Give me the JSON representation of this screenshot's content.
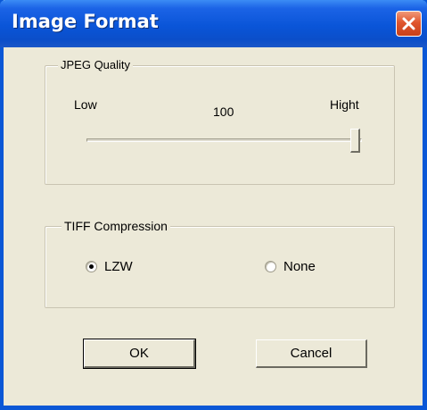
{
  "window": {
    "title": "Image Format"
  },
  "titlebar": {
    "close_icon": "close-x-icon",
    "close_color": "#e0562e"
  },
  "jpeg_group": {
    "legend": "JPEG Quality",
    "low_label": "Low",
    "high_label": "Hight",
    "value": "100",
    "slider_value": 100,
    "slider_min": 0,
    "slider_max": 100
  },
  "tiff_group": {
    "legend": "TIFF Compression",
    "options": [
      {
        "label": "LZW",
        "selected": true
      },
      {
        "label": "None",
        "selected": false
      }
    ]
  },
  "buttons": {
    "ok_label": "OK",
    "cancel_label": "Cancel"
  },
  "colors": {
    "titlebar": "#0a55d8",
    "dialog_bg": "#ece9d8"
  }
}
